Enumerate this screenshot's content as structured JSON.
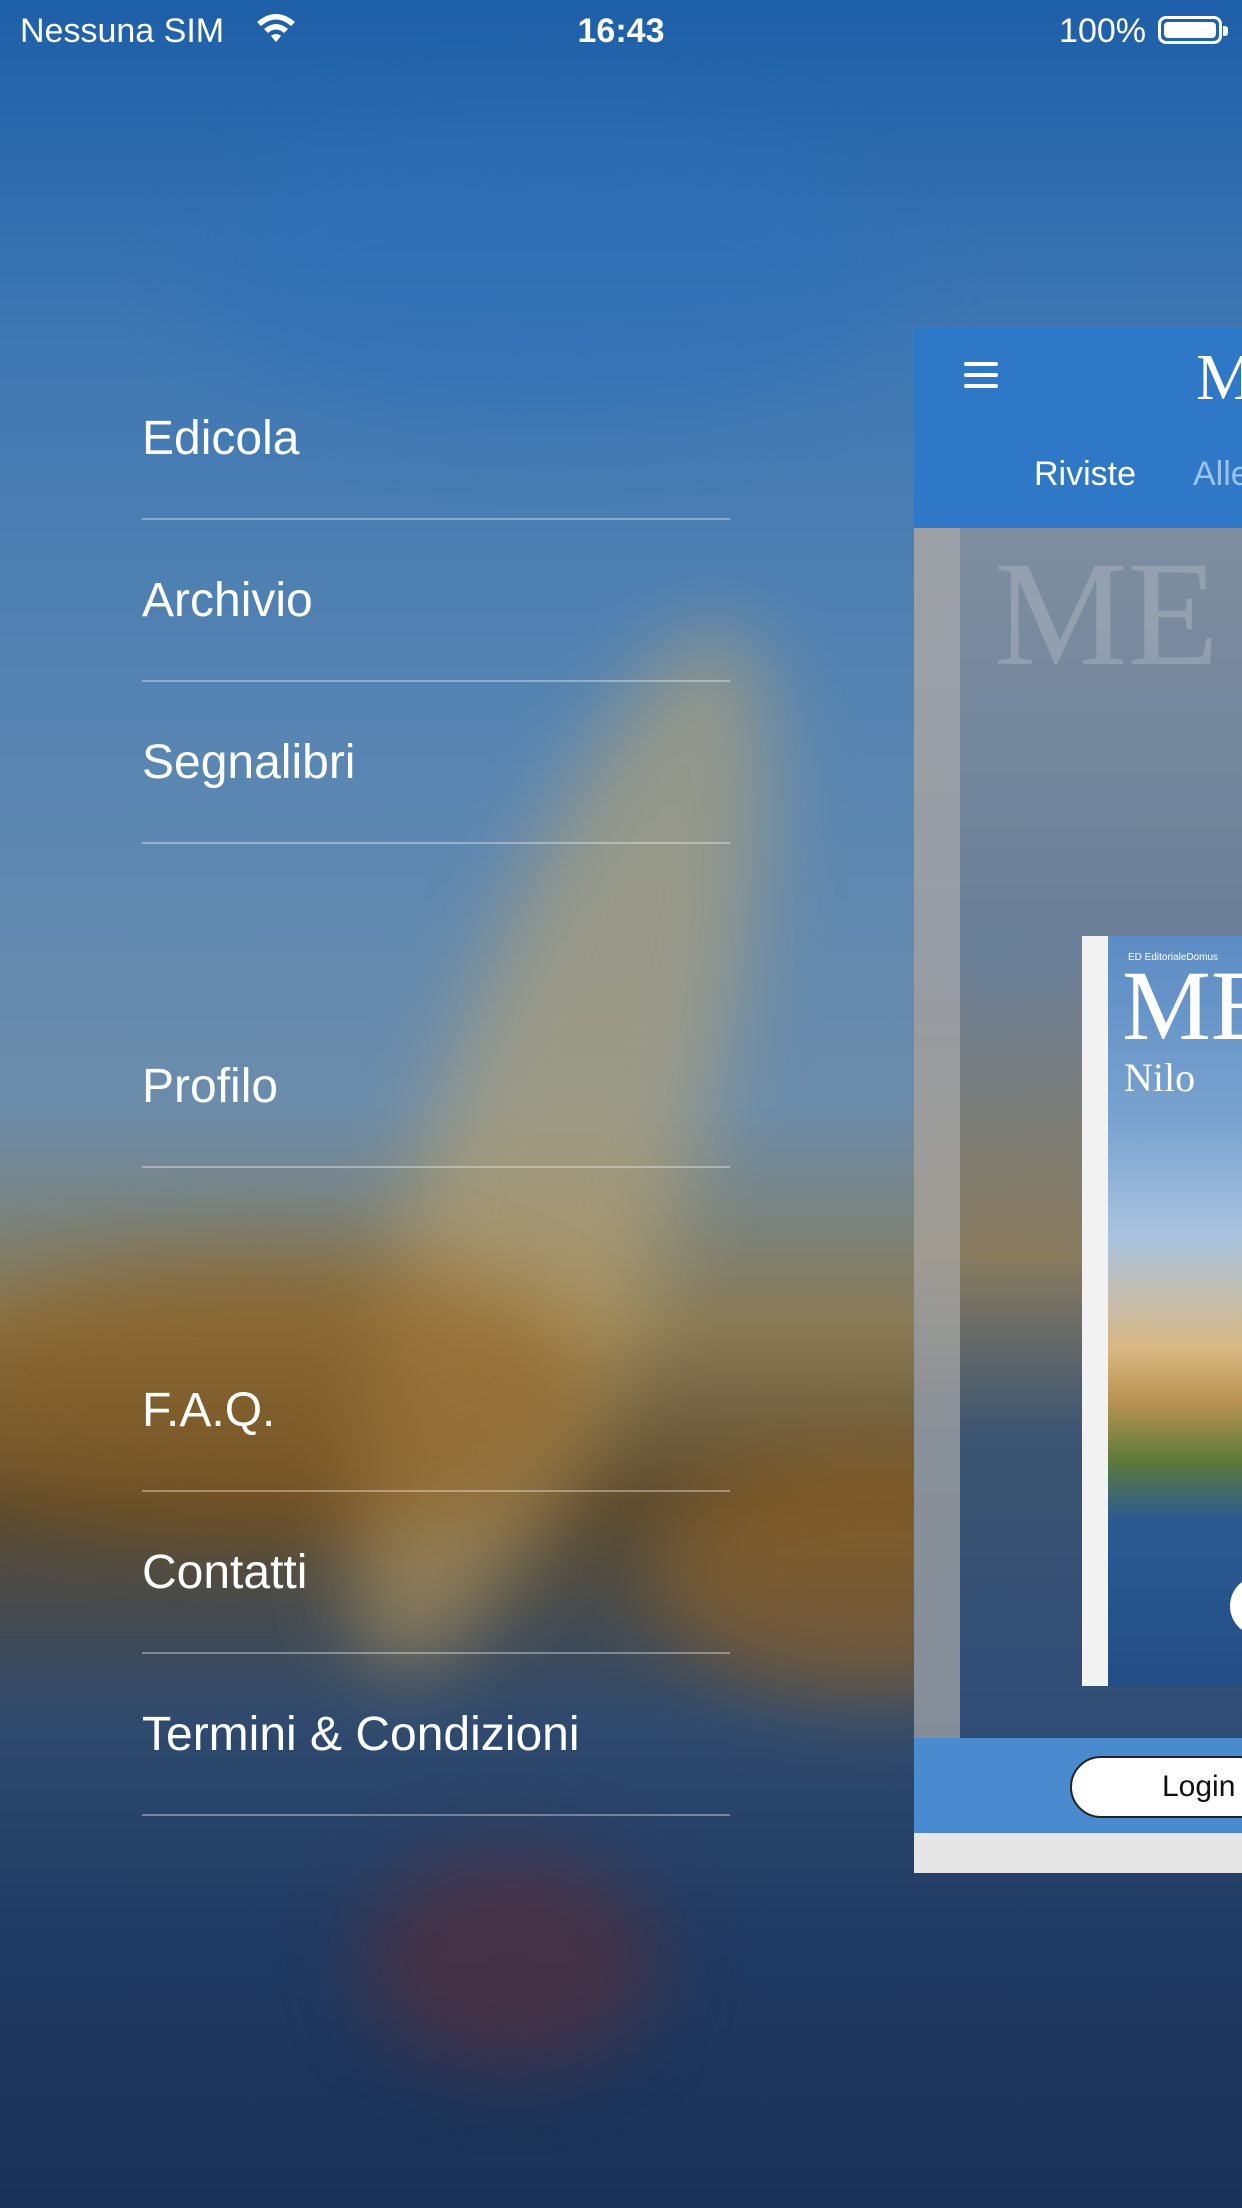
{
  "status_bar": {
    "carrier": "Nessuna SIM",
    "time": "16:43",
    "battery": "100%"
  },
  "menu": {
    "items": [
      {
        "label": "Edicola"
      },
      {
        "label": "Archivio"
      },
      {
        "label": "Segnalibri"
      },
      {
        "label": "Profilo"
      },
      {
        "label": "F.A.Q."
      },
      {
        "label": "Contatti"
      },
      {
        "label": "Termini & Condizioni"
      }
    ]
  },
  "preview": {
    "logo": "M",
    "tabs": [
      "Riviste",
      "Alle"
    ],
    "cover": {
      "publisher": "ED EditorialeDomus",
      "title": "ME",
      "subtitle": "Nilo"
    },
    "ghost_title": "ME",
    "login_label": "Login",
    "colors": {
      "header": "#2f78c7",
      "footer": "#4a8bd0"
    }
  }
}
